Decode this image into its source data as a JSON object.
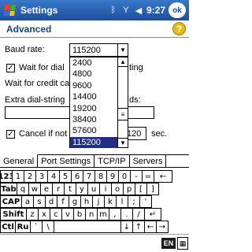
{
  "titlebar": {
    "title": "Settings",
    "time": "9:27",
    "ok_label": "ok",
    "icons": [
      "start-menu-icon",
      "bluetooth-icon",
      "signal-icon",
      "speaker-icon"
    ]
  },
  "header": {
    "title": "Advanced",
    "help_label": "?"
  },
  "baud": {
    "label": "Baud rate:",
    "value": "115200",
    "options": [
      "2400",
      "4800",
      "9600",
      "14400",
      "19200",
      "38400",
      "57600",
      "115200"
    ],
    "selected_index": 7
  },
  "wait_dial": {
    "label_left": "Wait for dial",
    "label_right": "ting",
    "checked": true
  },
  "wait_credit": {
    "label": "Wait for credit ca"
  },
  "extra_dial": {
    "label_left": "Extra dial-string",
    "label_right": "ds:"
  },
  "cancel": {
    "label": "Cancel if not",
    "value": "120",
    "unit": "sec.",
    "checked": true
  },
  "tabs": [
    "General",
    "Port Settings",
    "TCP/IP",
    "Servers"
  ],
  "keyboard": {
    "row1": [
      "123",
      "1",
      "2",
      "3",
      "4",
      "5",
      "6",
      "7",
      "8",
      "9",
      "0",
      "-",
      "=",
      "←"
    ],
    "row2": [
      "Tab",
      "q",
      "w",
      "e",
      "r",
      "t",
      "y",
      "u",
      "i",
      "o",
      "p",
      "[",
      "]"
    ],
    "row3": [
      "CAP",
      "a",
      "s",
      "d",
      "f",
      "g",
      "h",
      "j",
      "k",
      "l",
      ";",
      "'"
    ],
    "row4": [
      "Shift",
      "z",
      "x",
      "c",
      "v",
      "b",
      "n",
      "m",
      ",",
      ".",
      "/",
      "↵"
    ],
    "row5": [
      "Ctl",
      "Ru",
      "`",
      "\\",
      "",
      "↓",
      "↑",
      "←",
      "→"
    ]
  },
  "bottom": {
    "lang": "EN",
    "kbd_icon": "▦"
  }
}
